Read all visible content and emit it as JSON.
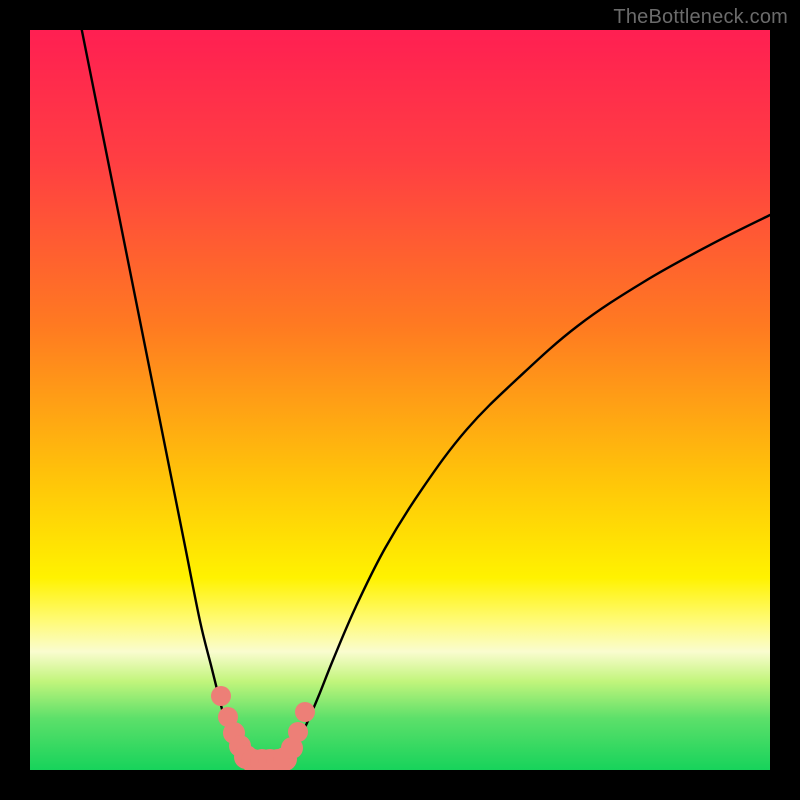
{
  "watermark": "TheBottleneck.com",
  "chart_data": {
    "type": "line",
    "title": "",
    "xlabel": "",
    "ylabel": "",
    "ylim": [
      0,
      100
    ],
    "xlim": [
      0,
      100
    ],
    "gradient_stops": [
      {
        "offset": 0,
        "color": "#ff1f52"
      },
      {
        "offset": 18,
        "color": "#ff3f42"
      },
      {
        "offset": 40,
        "color": "#ff7a21"
      },
      {
        "offset": 60,
        "color": "#ffc20a"
      },
      {
        "offset": 74,
        "color": "#fff200"
      },
      {
        "offset": 80,
        "color": "#fffb7a"
      },
      {
        "offset": 84,
        "color": "#fafccf"
      },
      {
        "offset": 88,
        "color": "#c2f57c"
      },
      {
        "offset": 93,
        "color": "#5de06a"
      },
      {
        "offset": 100,
        "color": "#17d35b"
      }
    ],
    "series": [
      {
        "name": "left-curve",
        "x": [
          7,
          9,
          11,
          13,
          15,
          17,
          19,
          21,
          23,
          24.5,
          25.5,
          26.3,
          27.2,
          28,
          28.6,
          29.1,
          29.5
        ],
        "y": [
          100,
          90,
          80,
          70,
          60,
          50,
          40,
          30,
          20,
          14,
          10,
          7,
          5,
          3.2,
          2,
          1,
          0.3
        ]
      },
      {
        "name": "right-curve",
        "x": [
          34.5,
          35,
          35.6,
          36.4,
          37.5,
          39,
          41,
          44,
          48,
          53,
          59,
          66,
          74,
          83,
          92,
          100
        ],
        "y": [
          0.3,
          1.2,
          2.5,
          4.2,
          6.5,
          10,
          15,
          22,
          30,
          38,
          46,
          53,
          60,
          66,
          71,
          75
        ]
      }
    ],
    "markers": [
      {
        "x": 25.8,
        "y": 10.0,
        "r": 10
      },
      {
        "x": 26.8,
        "y": 7.2,
        "r": 10
      },
      {
        "x": 27.6,
        "y": 5.0,
        "r": 11
      },
      {
        "x": 28.4,
        "y": 3.2,
        "r": 11
      },
      {
        "x": 29.2,
        "y": 1.8,
        "r": 12
      },
      {
        "x": 30.2,
        "y": 1.2,
        "r": 12
      },
      {
        "x": 31.3,
        "y": 1.2,
        "r": 12
      },
      {
        "x": 32.4,
        "y": 1.2,
        "r": 12
      },
      {
        "x": 33.5,
        "y": 1.2,
        "r": 12
      },
      {
        "x": 34.5,
        "y": 1.5,
        "r": 12
      },
      {
        "x": 35.4,
        "y": 3.0,
        "r": 11
      },
      {
        "x": 36.2,
        "y": 5.2,
        "r": 10
      },
      {
        "x": 37.1,
        "y": 7.8,
        "r": 10
      }
    ]
  }
}
